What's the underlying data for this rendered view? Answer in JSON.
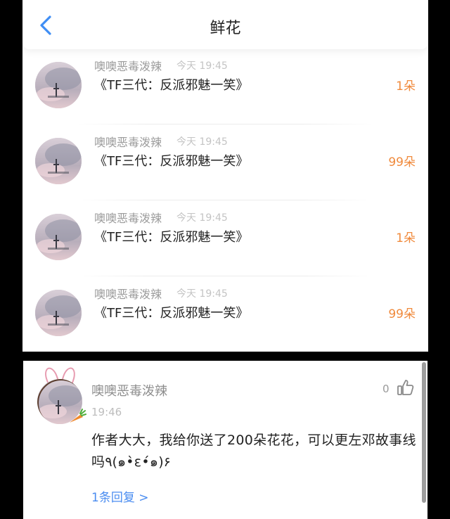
{
  "header": {
    "title": "鲜花",
    "back_icon": "chevron-left-icon",
    "accent_color": "#3f8ef4"
  },
  "gifts": [
    {
      "user": "噢噢恶毒泼辣",
      "time": "今天 19:45",
      "book": "《TF三代：反派邪魅一笑》",
      "count": "1朵"
    },
    {
      "user": "噢噢恶毒泼辣",
      "time": "今天 19:45",
      "book": "《TF三代：反派邪魅一笑》",
      "count": "99朵"
    },
    {
      "user": "噢噢恶毒泼辣",
      "time": "今天 19:45",
      "book": "《TF三代：反派邪魅一笑》",
      "count": "1朵"
    },
    {
      "user": "噢噢恶毒泼辣",
      "time": "今天 19:45",
      "book": "《TF三代：反派邪魅一笑》",
      "count": "99朵"
    }
  ],
  "comment": {
    "user": "噢噢恶毒泼辣",
    "time": "19:46",
    "likes": "0",
    "like_icon": "thumbs-up-icon",
    "body": "作者大大，我给你送了200朵花花，可以更左邓故事线吗٩(๑•̀ε•́๑)۶",
    "replies": "1条回复 >"
  }
}
